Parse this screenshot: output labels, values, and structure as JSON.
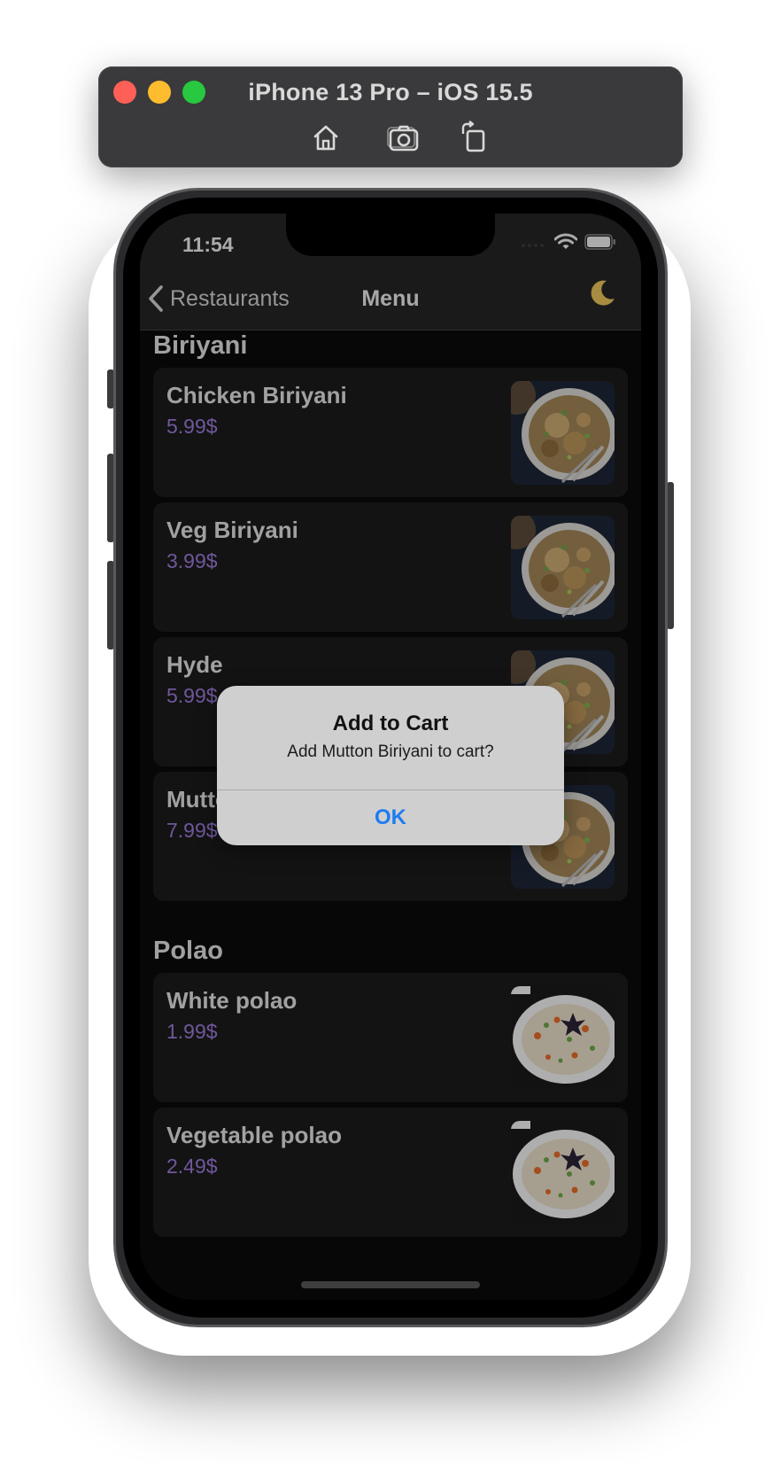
{
  "simulator": {
    "title": "iPhone 13 Pro – iOS 15.5",
    "toolbar": [
      {
        "icon": "home-icon"
      },
      {
        "icon": "screenshot-icon"
      },
      {
        "icon": "rotate-icon"
      }
    ]
  },
  "status_bar": {
    "time": "11:54"
  },
  "navbar": {
    "back_label": "Restaurants",
    "title": "Menu",
    "theme_icon": "moon-icon"
  },
  "sections": [
    {
      "title": "Biriyani",
      "items": [
        {
          "name": "Chicken Biriyani",
          "price": "5.99$",
          "image": "biriyani"
        },
        {
          "name": "Veg Biriyani",
          "price": "3.99$",
          "image": "biriyani"
        },
        {
          "name": "Hyde",
          "price": "5.99$",
          "image": "biriyani"
        },
        {
          "name": "Mutton Biriyani",
          "price": "7.99$",
          "image": "biriyani"
        }
      ]
    },
    {
      "title": "Polao",
      "items": [
        {
          "name": "White polao",
          "price": "1.99$",
          "image": "polao"
        },
        {
          "name": "Vegetable polao",
          "price": "2.49$",
          "image": "polao"
        }
      ]
    }
  ],
  "alert": {
    "title": "Add to Cart",
    "message": "Add Mutton Biriyani to cart?",
    "ok_label": "OK"
  },
  "colors": {
    "price": "#9c79d8",
    "alert_button": "#1d7cf0",
    "moon": "#e8c35a"
  }
}
